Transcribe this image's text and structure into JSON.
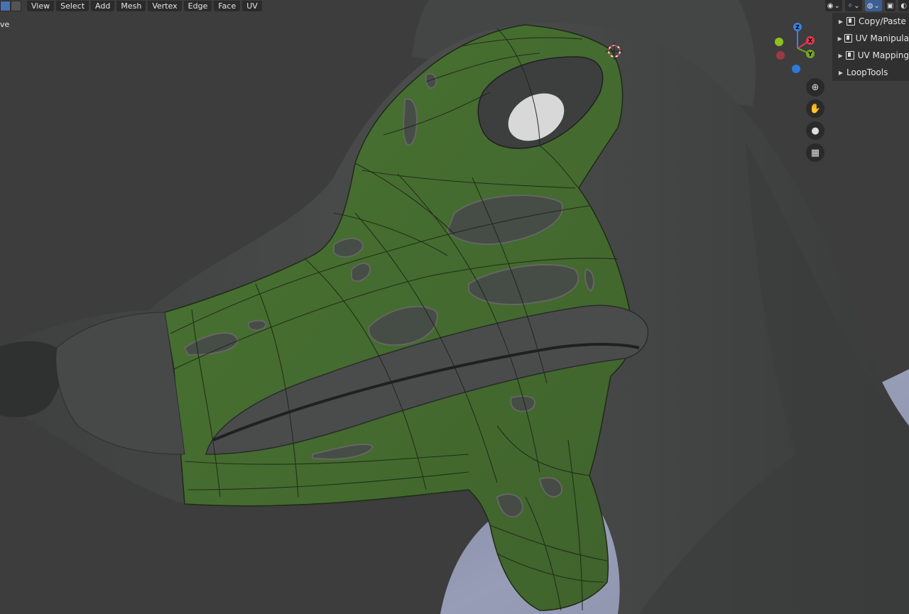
{
  "header": {
    "menus": [
      "View",
      "Select",
      "Add",
      "Mesh",
      "Vertex",
      "Edge",
      "Face",
      "UV"
    ],
    "status_text": "ve"
  },
  "sidebar_panel": {
    "items": [
      {
        "label": "Copy/Paste",
        "icon": "addon-icon"
      },
      {
        "label": "UV Manipula",
        "icon": "addon-icon"
      },
      {
        "label": "UV Mapping",
        "icon": "addon-icon"
      },
      {
        "label": "LoopTools",
        "icon": ""
      }
    ]
  },
  "gizmo": {
    "x_label": "X",
    "y_label": "Y",
    "z_label": "Z",
    "colors": {
      "x": "#e0384f",
      "y": "#76a51f",
      "z": "#3b82e0"
    }
  },
  "nav_buttons": [
    "zoom-icon",
    "hand-icon",
    "camera-icon",
    "grid-icon"
  ],
  "viewport": {
    "background": "#3d3d3d",
    "mesh_color": "#494b4b",
    "selection_color": "#4e7a36",
    "collar_color": "#8e94ad"
  }
}
